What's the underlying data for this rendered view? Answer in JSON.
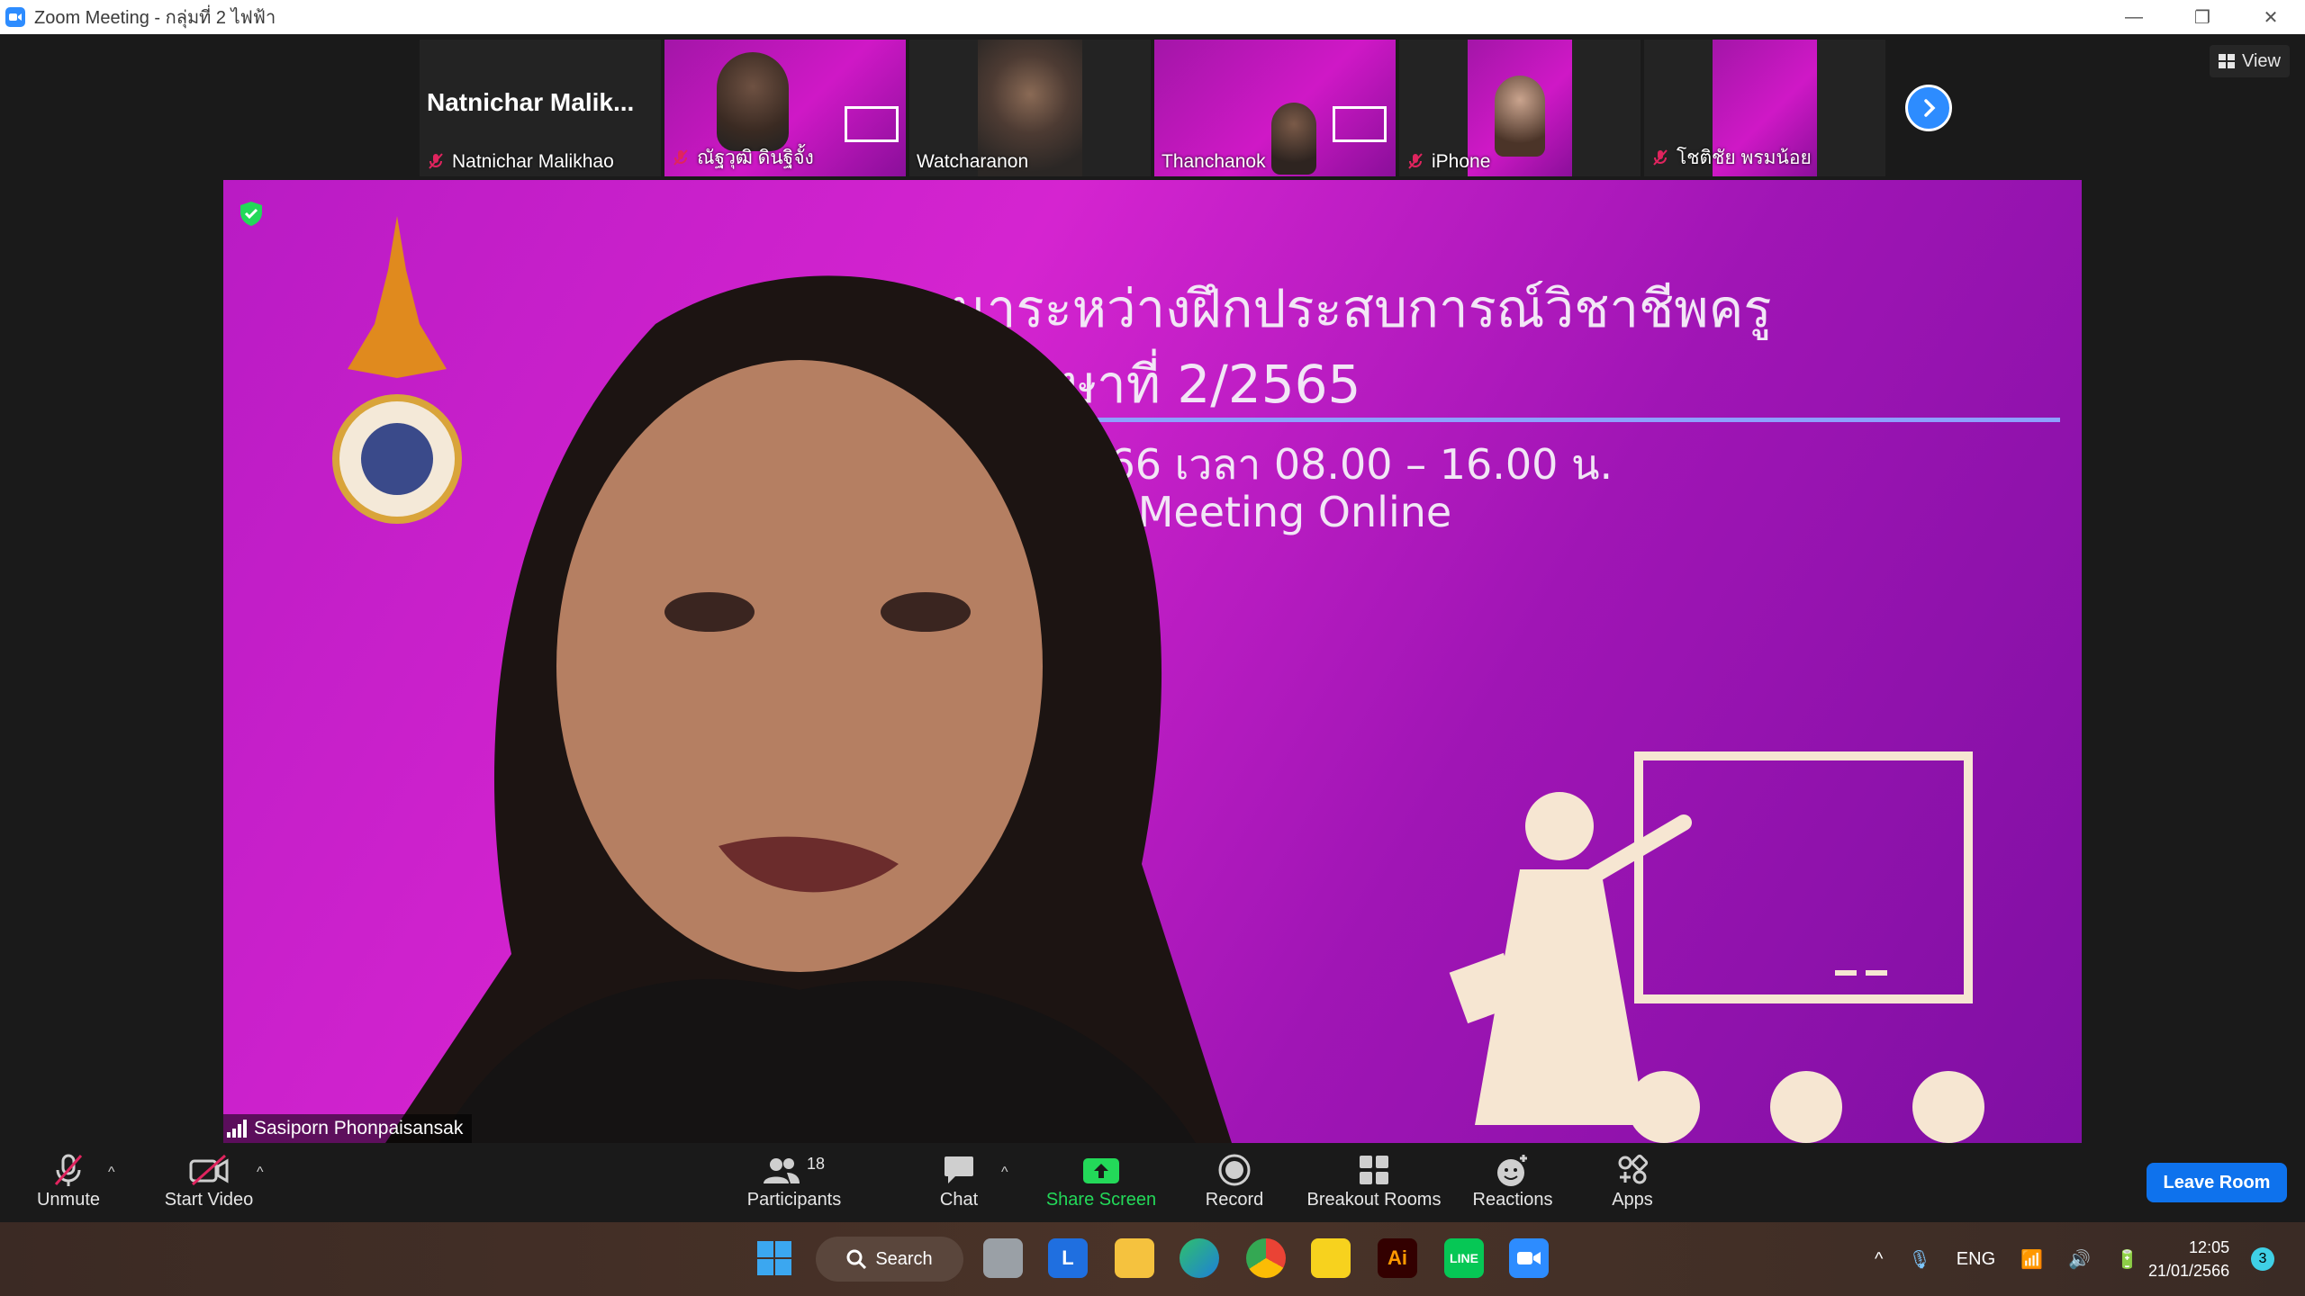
{
  "window": {
    "title": "Zoom Meeting - กลุ่มที่ 2 ไฟฟ้า",
    "minimize": "—",
    "restore": "❐",
    "close": "✕"
  },
  "gallery": {
    "tiles": [
      {
        "name": "Natnichar Malikhao",
        "header": "Natnichar  Malik...",
        "muted": true
      },
      {
        "name": "ณัฐวุฒิ ดินฐิจั้ง",
        "muted": true
      },
      {
        "name": "Watcharanon",
        "muted": false
      },
      {
        "name": "Thanchanok",
        "muted": false
      },
      {
        "name": "iPhone",
        "muted": true
      },
      {
        "name": "โชติชัย พรมน้อย",
        "muted": true
      }
    ],
    "view_label": "View"
  },
  "speaker": {
    "name": "Sasiporn Phonpaisansak",
    "slide_line1": "มนาระหว่างฝึกประสบการณ์วิชาชีพครู",
    "slide_line2": "ศึกษาที่ 2/2565",
    "slide_line3": "ม 2566 เวลา 08.00 – 16.00 น.",
    "slide_line4": "oom Meeting Online"
  },
  "toolbar": {
    "unmute": "Unmute",
    "start_video": "Start Video",
    "participants": "Participants",
    "participants_count": "18",
    "chat": "Chat",
    "share_screen": "Share Screen",
    "record": "Record",
    "breakout_rooms": "Breakout Rooms",
    "reactions": "Reactions",
    "apps": "Apps",
    "leave": "Leave Room"
  },
  "taskbar": {
    "search": "Search",
    "language": "ENG",
    "time": "12:05",
    "date": "21/01/2566",
    "notifications": "3"
  },
  "colors": {
    "zoom_blue": "#2d8cff",
    "leave_blue": "#0e72ed",
    "share_green": "#23d959",
    "slide_magenta": "#c91fc8"
  }
}
